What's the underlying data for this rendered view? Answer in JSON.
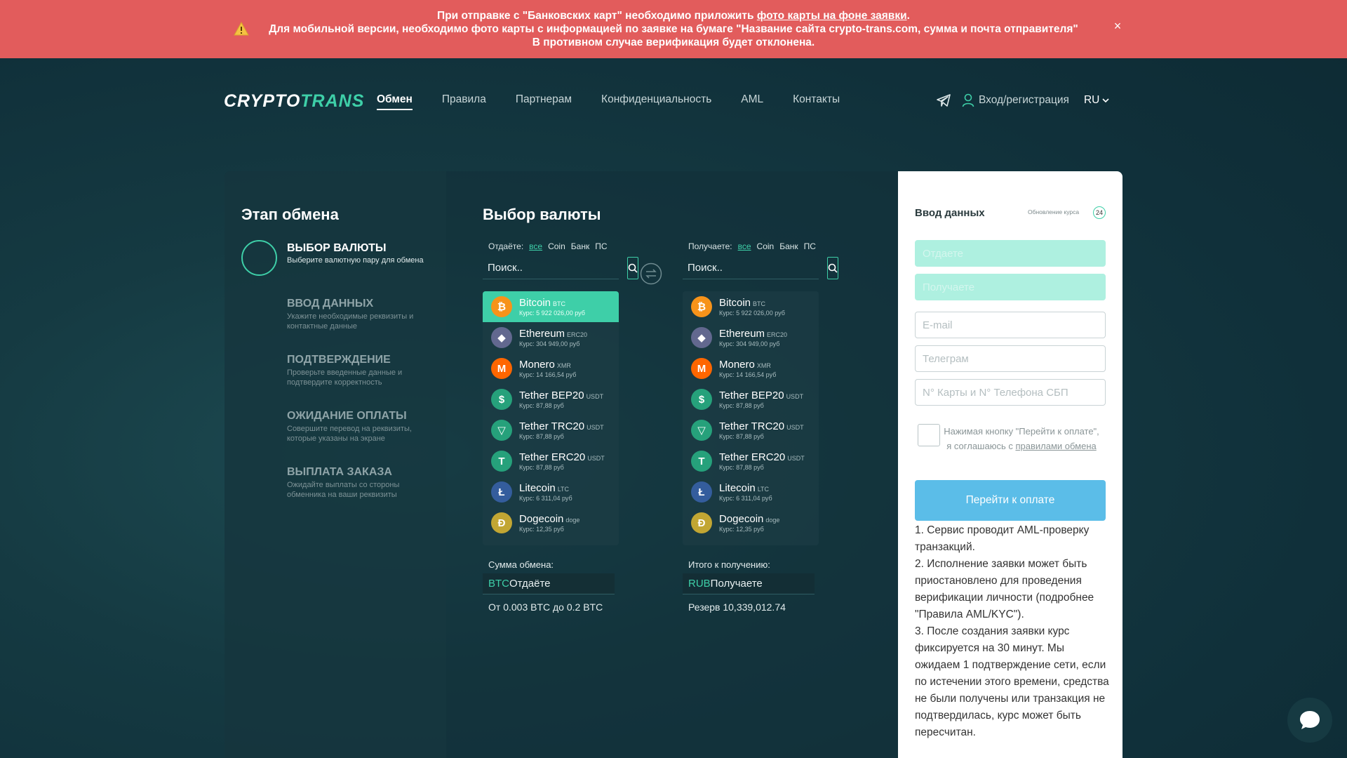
{
  "alert": {
    "line1_pre": "При отправке с \"Банковских карт\" необходимо приложить ",
    "line1_link": "фото карты на фоне заявки",
    "line1_post": ".",
    "line2": "Для мобильной версии, необходимо фото карты с информацией по заявке на бумаге \"Название сайта crypto-trans.com, сумма и почта отправителя\"",
    "line3": "В противном случае верификация будет отклонена.",
    "close": "×"
  },
  "header": {
    "logo_part1": "CRYPTO",
    "logo_part2": "TRANS",
    "nav": [
      "Обмен",
      "Правила",
      "Партнерам",
      "Конфиденциальность",
      "AML",
      "Контакты"
    ],
    "login": "Вход/регистрация",
    "lang": "RU"
  },
  "steps": {
    "title": "Этап обмена",
    "items": [
      {
        "title": "ВЫБОР ВАЛЮТЫ",
        "desc": "Выберите валютную пару для обмена"
      },
      {
        "title": "ВВОД ДАННЫХ",
        "desc": "Укажите необходимые реквизиты и контактные данные"
      },
      {
        "title": "ПОДТВЕРЖДЕНИЕ",
        "desc": "Проверьте введенные данные и подтвердите корректность"
      },
      {
        "title": "ОЖИДАНИЕ ОПЛАТЫ",
        "desc": "Совершите перевод на реквизиты, которые указаны на экране"
      },
      {
        "title": "ВЫПЛАТА ЗАКАЗА",
        "desc": "Ожидайте выплаты со стороны обменника на ваши реквизиты"
      }
    ]
  },
  "currency": {
    "title": "Выбор валюты",
    "give": {
      "label": "Отдаёте:",
      "filters": [
        "все",
        "Coin",
        "Банк",
        "ПС"
      ],
      "search_placeholder": "Поиск..",
      "amount_label": "Сумма обмена:",
      "amount_currency": "BTC",
      "amount_placeholder": "Отдаёте",
      "note": "От 0.003 BTC до 0.2 BTC"
    },
    "get": {
      "label": "Получаете:",
      "filters": [
        "все",
        "Coin",
        "Банк",
        "ПС"
      ],
      "search_placeholder": "Поиск..",
      "amount_label": "Итого к получению:",
      "amount_currency": "RUB",
      "amount_placeholder": "Получаете",
      "note": "Резерв 10,339,012.74"
    },
    "coins": [
      {
        "name": "Bitcoin",
        "ticker": "BTC",
        "rate": "Курс: 5 922 026,00 руб",
        "color": "#f7931a",
        "glyph": "₿"
      },
      {
        "name": "Ethereum",
        "ticker": "ERC20",
        "rate": "Курс: 304 949,00 руб",
        "color": "#62688f",
        "glyph": "◆"
      },
      {
        "name": "Monero",
        "ticker": "XMR",
        "rate": "Курс: 14 166,54 руб",
        "color": "#ff6600",
        "glyph": "M"
      },
      {
        "name": "Tether BEP20",
        "ticker": "USDT",
        "rate": "Курс: 87,88 руб",
        "color": "#26a17b",
        "glyph": "$"
      },
      {
        "name": "Tether TRC20",
        "ticker": "USDT",
        "rate": "Курс: 87,88 руб",
        "color": "#26a17b",
        "glyph": "▽"
      },
      {
        "name": "Tether ERC20",
        "ticker": "USDT",
        "rate": "Курс: 87,88 руб",
        "color": "#26a17b",
        "glyph": "T"
      },
      {
        "name": "Litecoin",
        "ticker": "LTC",
        "rate": "Курс: 6 311,04 руб",
        "color": "#345d9d",
        "glyph": "Ł"
      },
      {
        "name": "Dogecoin",
        "ticker": "doge",
        "rate": "Курс: 12,35 руб",
        "color": "#c2a633",
        "glyph": "Ð"
      }
    ]
  },
  "form": {
    "title": "Ввод данных",
    "rate_update": "Обновление курса",
    "timer": "24",
    "give_placeholder": "Отдаете",
    "get_placeholder": "Получаете",
    "email_placeholder": "E-mail",
    "telegram_placeholder": "Телеграм",
    "card_placeholder": "N° Карты и N° Телефона СБП",
    "agree_pre": "Нажимая кнопку \"Перейти к оплате\", я соглашаюсь с ",
    "agree_link": "правилами обмена",
    "pay_button": "Перейти к оплате",
    "notes": [
      "1. Сервис проводит AML-проверку транзакций.",
      "2. Исполнение заявки может быть приостановлено для проведения верификации личности (подробнее \"Правила AML/KYC\").",
      "3. После создания заявки курс фиксируется на 30 минут. Мы ожидаем 1 подтверждение сети, если по истечении этого времени, средства не были получены или транзакция не подтвердилась, курс может быть пересчитан."
    ]
  },
  "colors": {
    "accent": "#3ecfa8",
    "alert": "#e25c5c",
    "button": "#5bbde8"
  }
}
